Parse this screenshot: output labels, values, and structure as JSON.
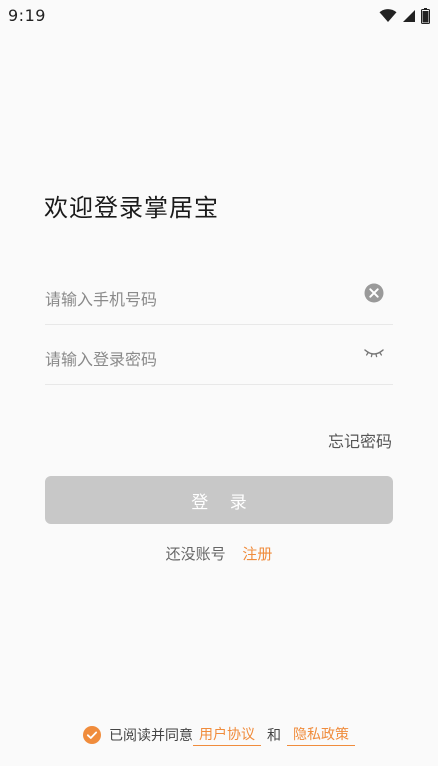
{
  "status_bar": {
    "time": "9:19",
    "icons": [
      "wifi-icon",
      "signal-icon",
      "battery-icon"
    ]
  },
  "login": {
    "title": "欢迎登录掌居宝",
    "phone_placeholder": "请输入手机号码",
    "password_placeholder": "请输入登录密码",
    "clear_icon": "clear-icon",
    "password_toggle_icon": "eye-closed-icon",
    "forgot_password": "忘记密码",
    "login_button": "登 录",
    "no_account": "还没账号",
    "register": "注册"
  },
  "agreement": {
    "checked": true,
    "prefix": "已阅读并同意",
    "user_agreement": "用户协议",
    "and": "和",
    "privacy_policy": "隐私政策"
  },
  "colors": {
    "accent": "#f08c3c",
    "button_disabled": "#c8c8c8",
    "background": "#fafafa"
  }
}
